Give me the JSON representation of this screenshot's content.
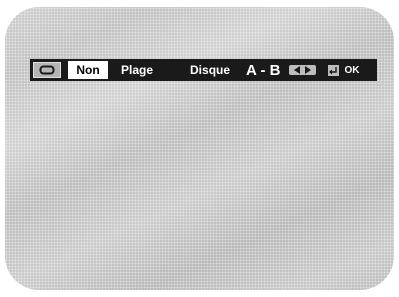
{
  "osd": {
    "options": [
      "Non",
      "Plage",
      "Disque"
    ],
    "ab_label": "A - B",
    "ok_label": "OK",
    "selected_option": "Non"
  },
  "icons": {
    "mode": "repeat-icon",
    "navigate": "left-right-arrows-icon",
    "confirm": "enter-icon"
  },
  "colors": {
    "bar": "#1a1a1a",
    "selected_bg": "#ffffff",
    "screen": "#c6c6c6"
  }
}
